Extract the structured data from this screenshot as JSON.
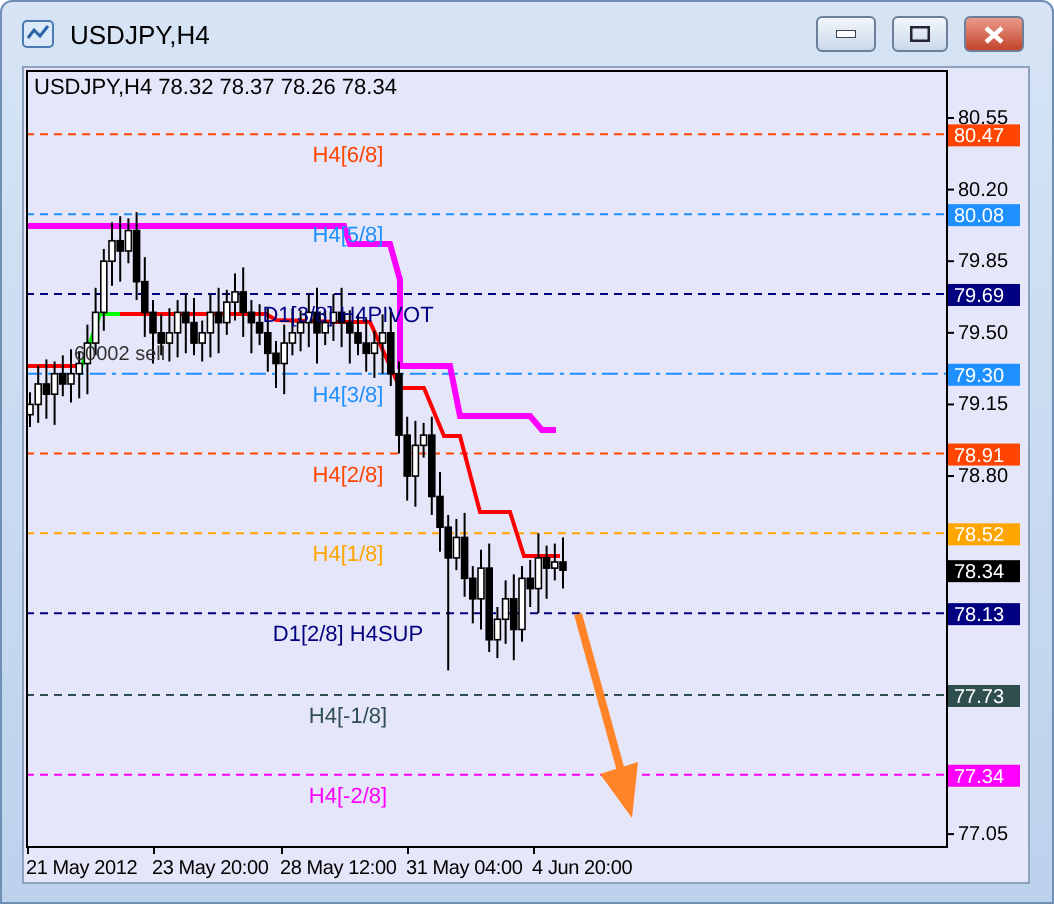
{
  "window": {
    "title": "USDJPY,H4"
  },
  "chart": {
    "header": "USDJPY,H4  78.32 78.37 78.26 78.34",
    "trade_label": "60002 sell",
    "levels": [
      {
        "label": "H4[6/8]",
        "price": "80.47",
        "color": "#ff4500",
        "kind": "dashed"
      },
      {
        "label": "H4[5/8]",
        "price": "80.08",
        "color": "#1e90ff",
        "kind": "dashed"
      },
      {
        "label": "D1[3/8] H4PIVOT",
        "price": "79.69",
        "color": "#000080",
        "kind": "dashed"
      },
      {
        "label": "H4[3/8]",
        "price": "79.30",
        "color": "#1e90ff",
        "kind": "dashdot"
      },
      {
        "label": "H4[2/8]",
        "price": "78.91",
        "color": "#ff4500",
        "kind": "dashed"
      },
      {
        "label": "H4[1/8]",
        "price": "78.52",
        "color": "#ffa500",
        "kind": "dashed"
      },
      {
        "label": "D1[2/8] H4SUP",
        "price": "78.13",
        "color": "#000080",
        "kind": "dashed"
      },
      {
        "label": "H4[-1/8]",
        "price": "77.73",
        "color": "#2f4f4f",
        "kind": "dashed"
      },
      {
        "label": "H4[-2/8]",
        "price": "77.34",
        "color": "#ff00ff",
        "kind": "dashed"
      }
    ],
    "current_price": "78.34",
    "yticks": [
      "80.55",
      "80.20",
      "79.85",
      "79.50",
      "79.15",
      "78.80",
      "77.05"
    ],
    "xticks": [
      "21 May 2012",
      "23 May 20:00",
      "28 May 12:00",
      "31 May 04:00",
      "4 Jun 20:00"
    ]
  }
}
